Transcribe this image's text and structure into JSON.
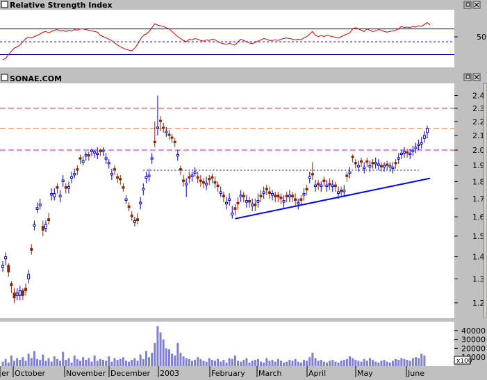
{
  "rsi_panel": {
    "title": "Relative Strength Index",
    "tick_labels": [
      "50"
    ],
    "levels": [
      70,
      50,
      30
    ],
    "ylim": [
      10,
      100
    ]
  },
  "price_panel": {
    "title": "SONAE.COM",
    "tick_labels": [
      "2.4",
      "2.3",
      "2.2",
      "2.1",
      "2.0",
      "1.9",
      "1.8",
      "1.7",
      "1.6",
      "1.5",
      "1.4",
      "1.3",
      "1.2"
    ]
  },
  "volume_panel": {
    "tick_labels": [
      "40000",
      "30000",
      "20000",
      "10000"
    ],
    "multiplier_label": "x100"
  },
  "months": [
    "er",
    "October",
    "November",
    "December",
    "2003",
    "February",
    "March",
    "April",
    "May",
    "June"
  ],
  "colors": {
    "up": "#0000c0",
    "down": "#8b2500",
    "rsi": "#d00000",
    "line_blue": "#0000ff",
    "dash_red": "#b03020",
    "dash_orange": "#e07030",
    "dash_magenta": "#e000e0",
    "dotted": "#000060",
    "volume": "#8080d0"
  },
  "chart_data": {
    "type": "candlestick",
    "x_axis": "date (Sep 2002 – Jun 2003), monthly tick labels",
    "y_scale": "log",
    "ylim": [
      1.14,
      2.5
    ],
    "horizontal_levels": [
      {
        "value": 2.3,
        "style": "dashed",
        "color": "#b03020"
      },
      {
        "value": 2.15,
        "style": "dashed",
        "color": "#e07030"
      },
      {
        "value": 2.0,
        "style": "dashed",
        "color": "#e000e0"
      },
      {
        "value": 1.87,
        "style": "dotted",
        "color": "#000060",
        "from_index": 49,
        "to_index": 145
      }
    ],
    "trendline": {
      "start": [
        81,
        1.59
      ],
      "end": [
        149,
        1.82
      ],
      "color": "#0000ff"
    },
    "closes": [
      1.36,
      1.4,
      1.33,
      1.27,
      1.22,
      1.24,
      1.25,
      1.23,
      1.25,
      1.32,
      1.43,
      1.56,
      1.65,
      1.67,
      1.53,
      1.56,
      1.58,
      1.73,
      1.73,
      1.76,
      1.72,
      1.81,
      1.76,
      1.77,
      1.83,
      1.85,
      1.87,
      1.94,
      1.93,
      1.97,
      1.96,
      2.0,
      1.99,
      1.98,
      1.99,
      2.0,
      1.95,
      1.92,
      1.85,
      1.87,
      1.82,
      1.81,
      1.76,
      1.7,
      1.65,
      1.6,
      1.58,
      1.58,
      1.68,
      1.76,
      1.83,
      1.84,
      1.95,
      2.05,
      2.16,
      2.2,
      2.15,
      2.13,
      2.1,
      2.08,
      2.05,
      1.97,
      1.87,
      1.8,
      1.79,
      1.82,
      1.84,
      1.86,
      1.82,
      1.8,
      1.79,
      1.79,
      1.81,
      1.82,
      1.79,
      1.77,
      1.74,
      1.71,
      1.68,
      1.7,
      1.62,
      1.64,
      1.67,
      1.72,
      1.71,
      1.69,
      1.68,
      1.67,
      1.66,
      1.69,
      1.71,
      1.74,
      1.75,
      1.73,
      1.73,
      1.71,
      1.71,
      1.7,
      1.69,
      1.71,
      1.72,
      1.71,
      1.69,
      1.68,
      1.69,
      1.73,
      1.75,
      1.83,
      1.84,
      1.78,
      1.78,
      1.78,
      1.8,
      1.78,
      1.78,
      1.78,
      1.77,
      1.74,
      1.74,
      1.75,
      1.83,
      1.86,
      1.95,
      1.91,
      1.9,
      1.92,
      1.89,
      1.92,
      1.9,
      1.91,
      1.92,
      1.91,
      1.89,
      1.9,
      1.9,
      1.9,
      1.89,
      1.91,
      1.95,
      1.98,
      1.99,
      1.98,
      1.98,
      2.0,
      2.02,
      2.04,
      2.05,
      2.1,
      2.15
    ],
    "opens": [
      1.35,
      1.39,
      1.36,
      1.28,
      1.24,
      1.23,
      1.23,
      1.25,
      1.26,
      1.3,
      1.44,
      1.55,
      1.64,
      1.66,
      1.55,
      1.54,
      1.59,
      1.72,
      1.71,
      1.77,
      1.71,
      1.8,
      1.77,
      1.76,
      1.82,
      1.84,
      1.88,
      1.95,
      1.92,
      1.96,
      1.97,
      1.99,
      1.98,
      1.97,
      2.0,
      1.99,
      1.94,
      1.91,
      1.84,
      1.88,
      1.83,
      1.82,
      1.77,
      1.69,
      1.66,
      1.61,
      1.57,
      1.59,
      1.67,
      1.75,
      1.82,
      1.83,
      1.94,
      2.06,
      2.15,
      2.21,
      2.16,
      2.12,
      2.11,
      2.09,
      2.06,
      1.96,
      1.88,
      1.81,
      1.78,
      1.83,
      1.83,
      1.85,
      1.83,
      1.81,
      1.8,
      1.78,
      1.82,
      1.83,
      1.8,
      1.78,
      1.73,
      1.72,
      1.67,
      1.69,
      1.61,
      1.65,
      1.68,
      1.71,
      1.72,
      1.68,
      1.69,
      1.66,
      1.67,
      1.68,
      1.72,
      1.73,
      1.76,
      1.74,
      1.72,
      1.72,
      1.72,
      1.71,
      1.68,
      1.72,
      1.71,
      1.72,
      1.7,
      1.67,
      1.7,
      1.72,
      1.76,
      1.82,
      1.85,
      1.77,
      1.79,
      1.77,
      1.81,
      1.77,
      1.79,
      1.77,
      1.78,
      1.73,
      1.75,
      1.74,
      1.84,
      1.85,
      1.96,
      1.92,
      1.89,
      1.93,
      1.88,
      1.93,
      1.89,
      1.92,
      1.91,
      1.9,
      1.9,
      1.89,
      1.91,
      1.89,
      1.88,
      1.92,
      1.94,
      1.97,
      1.98,
      1.99,
      1.97,
      1.99,
      2.01,
      2.03,
      2.04,
      2.08,
      2.12
    ],
    "highs": [
      1.38,
      1.42,
      1.37,
      1.29,
      1.26,
      1.26,
      1.27,
      1.26,
      1.28,
      1.34,
      1.46,
      1.58,
      1.68,
      1.7,
      1.58,
      1.58,
      1.62,
      1.76,
      1.76,
      1.79,
      1.75,
      1.84,
      1.79,
      1.8,
      1.86,
      1.88,
      1.9,
      1.97,
      1.96,
      1.99,
      1.99,
      2.01,
      2.0,
      2.02,
      2.01,
      2.02,
      1.98,
      1.94,
      1.88,
      1.9,
      1.85,
      1.84,
      1.79,
      1.72,
      1.68,
      1.63,
      1.6,
      1.62,
      1.71,
      1.79,
      1.86,
      1.88,
      1.98,
      2.2,
      2.4,
      2.24,
      2.19,
      2.16,
      2.14,
      2.11,
      2.08,
      2.0,
      1.9,
      1.84,
      1.82,
      1.86,
      1.86,
      1.89,
      1.86,
      1.84,
      1.82,
      1.83,
      1.84,
      1.85,
      1.83,
      1.8,
      1.77,
      1.74,
      1.71,
      1.73,
      1.66,
      1.67,
      1.71,
      1.75,
      1.74,
      1.72,
      1.71,
      1.7,
      1.7,
      1.73,
      1.75,
      1.77,
      1.78,
      1.77,
      1.75,
      1.74,
      1.74,
      1.73,
      1.72,
      1.74,
      1.75,
      1.74,
      1.73,
      1.7,
      1.72,
      1.76,
      1.78,
      1.86,
      1.92,
      1.81,
      1.81,
      1.8,
      1.83,
      1.81,
      1.82,
      1.81,
      1.8,
      1.77,
      1.77,
      1.78,
      1.86,
      1.89,
      1.97,
      1.94,
      1.93,
      1.95,
      1.92,
      1.95,
      1.93,
      1.94,
      1.95,
      1.94,
      1.92,
      1.92,
      1.93,
      1.92,
      1.92,
      1.94,
      1.98,
      2.0,
      2.02,
      2.01,
      2.01,
      2.03,
      2.05,
      2.07,
      2.09,
      2.13,
      2.17
    ],
    "lows": [
      1.33,
      1.36,
      1.31,
      1.24,
      1.2,
      1.21,
      1.21,
      1.21,
      1.23,
      1.28,
      1.41,
      1.53,
      1.62,
      1.64,
      1.5,
      1.52,
      1.56,
      1.69,
      1.69,
      1.73,
      1.68,
      1.77,
      1.73,
      1.73,
      1.79,
      1.82,
      1.84,
      1.91,
      1.9,
      1.93,
      1.93,
      1.96,
      1.95,
      1.94,
      1.96,
      1.96,
      1.91,
      1.88,
      1.81,
      1.84,
      1.79,
      1.78,
      1.74,
      1.67,
      1.63,
      1.58,
      1.55,
      1.56,
      1.64,
      1.72,
      1.79,
      1.8,
      1.91,
      2.02,
      2.1,
      2.13,
      2.12,
      2.09,
      2.07,
      2.05,
      2.02,
      1.93,
      1.84,
      1.77,
      1.71,
      1.79,
      1.8,
      1.83,
      1.79,
      1.77,
      1.76,
      1.75,
      1.78,
      1.79,
      1.76,
      1.74,
      1.71,
      1.68,
      1.64,
      1.66,
      1.59,
      1.61,
      1.64,
      1.68,
      1.68,
      1.65,
      1.65,
      1.63,
      1.63,
      1.65,
      1.68,
      1.7,
      1.72,
      1.7,
      1.69,
      1.68,
      1.68,
      1.67,
      1.65,
      1.68,
      1.68,
      1.68,
      1.66,
      1.64,
      1.66,
      1.69,
      1.72,
      1.79,
      1.81,
      1.74,
      1.75,
      1.74,
      1.77,
      1.74,
      1.75,
      1.74,
      1.74,
      1.7,
      1.71,
      1.71,
      1.8,
      1.82,
      1.92,
      1.88,
      1.86,
      1.89,
      1.85,
      1.89,
      1.86,
      1.88,
      1.88,
      1.87,
      1.86,
      1.86,
      1.87,
      1.86,
      1.85,
      1.88,
      1.91,
      1.94,
      1.95,
      1.95,
      1.94,
      1.96,
      1.98,
      2.0,
      2.01,
      2.05,
      2.08
    ],
    "volume": [
      50,
      80,
      40,
      120,
      60,
      90,
      70,
      100,
      60,
      140,
      90,
      170,
      80,
      70,
      130,
      60,
      90,
      50,
      110,
      80,
      60,
      160,
      70,
      90,
      40,
      120,
      80,
      60,
      100,
      70,
      90,
      50,
      120,
      60,
      80,
      70,
      60,
      110,
      50,
      90,
      70,
      80,
      100,
      60,
      50,
      70,
      90,
      60,
      130,
      80,
      170,
      100,
      150,
      260,
      450,
      380,
      300,
      200,
      190,
      140,
      120,
      260,
      150,
      110,
      90,
      80,
      60,
      70,
      100,
      80,
      60,
      50,
      90,
      70,
      60,
      80,
      50,
      70,
      40,
      90,
      80,
      120,
      60,
      50,
      70,
      90,
      40,
      60,
      70,
      80,
      50,
      40,
      90,
      60,
      70,
      50,
      80,
      60,
      40,
      50,
      70,
      60,
      80,
      50,
      40,
      70,
      60,
      100,
      150,
      90,
      60,
      70,
      50,
      40,
      60,
      70,
      50,
      40,
      60,
      70,
      80,
      110,
      90,
      70,
      60,
      50,
      80,
      60,
      90,
      70,
      50,
      40,
      60,
      70,
      50,
      40,
      60,
      80,
      70,
      90,
      80,
      70,
      60,
      90,
      100,
      90,
      140,
      120
    ],
    "rsi": [
      22,
      24,
      30,
      35,
      40,
      42,
      45,
      50,
      55,
      57,
      56,
      58,
      60,
      62,
      65,
      66,
      64,
      66,
      68,
      69,
      67,
      68,
      66,
      68,
      67,
      69,
      68,
      70,
      70,
      69,
      68,
      67,
      66,
      65,
      60,
      58,
      56,
      54,
      52,
      48,
      45,
      42,
      40,
      38,
      37,
      36,
      40,
      46,
      54,
      60,
      62,
      66,
      72,
      78,
      76,
      75,
      74,
      72,
      70,
      66,
      62,
      58,
      55,
      52,
      50,
      54,
      53,
      55,
      54,
      52,
      51,
      53,
      52,
      54,
      53,
      50,
      48,
      47,
      46,
      48,
      46,
      45,
      50,
      54,
      52,
      50,
      48,
      47,
      49,
      51,
      53,
      55,
      54,
      52,
      52,
      53,
      52,
      54,
      55,
      56,
      55,
      54,
      53,
      54,
      53,
      56,
      58,
      62,
      66,
      60,
      58,
      60,
      58,
      60,
      59,
      58,
      57,
      56,
      58,
      60,
      62,
      64,
      70,
      72,
      70,
      68,
      66,
      70,
      68,
      66,
      67,
      69,
      68,
      66,
      65,
      66,
      67,
      68,
      70,
      74,
      72,
      73,
      72,
      74,
      73,
      75,
      74,
      77,
      80,
      76
    ]
  }
}
